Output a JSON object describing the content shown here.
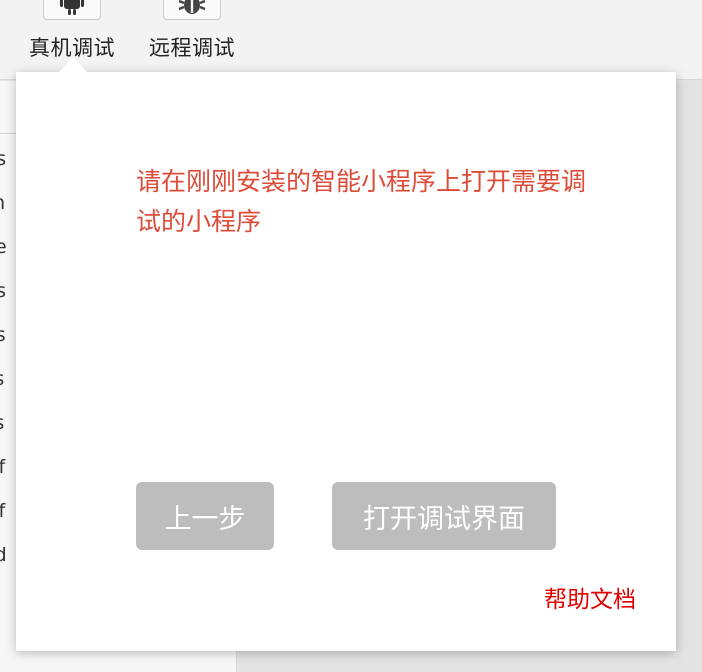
{
  "toolbar": {
    "device_debug_label": "真机调试",
    "remote_debug_label": "远程调试"
  },
  "file_list": {
    "items": [
      "ns",
      "m",
      "ge",
      "es",
      "cs",
      "js",
      "js",
      "nf",
      "nf",
      "ed"
    ]
  },
  "popover": {
    "instruction": "请在刚刚安装的智能小程序上打开需要调试的小程序",
    "prev_button": "上一步",
    "open_debug_button": "打开调试界面",
    "help_link": "帮助文档"
  },
  "colors": {
    "instruction_text": "#dd4b39",
    "help_link": "#e00000",
    "button_bg": "#bdbdbd"
  }
}
